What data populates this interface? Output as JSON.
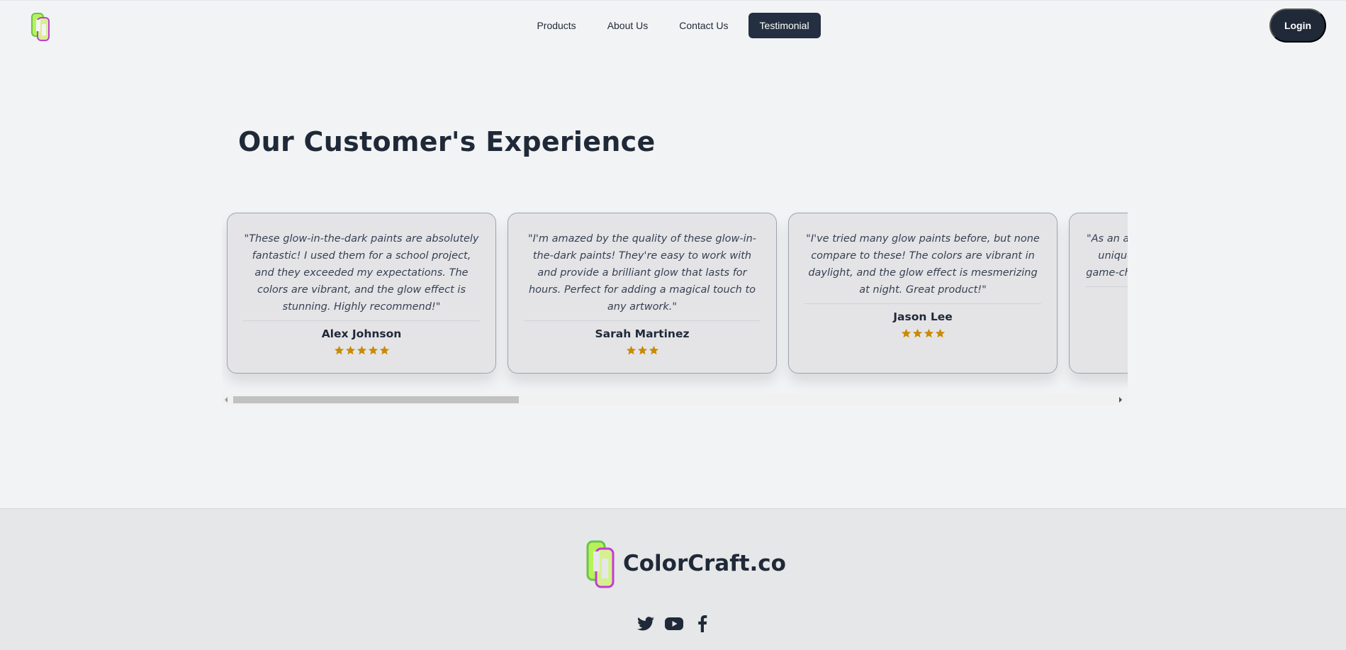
{
  "nav": {
    "items": [
      {
        "label": "Products"
      },
      {
        "label": "About Us"
      },
      {
        "label": "Contact Us"
      },
      {
        "label": "Testimonial"
      }
    ],
    "login_label": "Login"
  },
  "testimonials": {
    "title": "Our Customer's Experience",
    "cards": [
      {
        "quote": "\"These glow-in-the-dark paints are absolutely fantastic! I used them for a school project, and they exceeded my expectations. The colors are vibrant, and the glow effect is stunning. Highly recommend!\"",
        "author": "Alex Johnson",
        "rating": 5
      },
      {
        "quote": "\"I'm amazed by the quality of these glow-in-the-dark paints! They're easy to work with and provide a brilliant glow that lasts for hours. Perfect for adding a magical touch to any artwork.\"",
        "author": "Sarah Martinez",
        "rating": 3
      },
      {
        "quote": "\"I've tried many glow paints before, but none compare to these! The colors are vibrant in daylight, and the glow effect is mesmerizing at night. Great product!\"",
        "author": "Jason Lee",
        "rating": 4
      },
      {
        "quote": "\"As an artist, I love how these paints open up unique possibilities. They've been a total game-changer for my murals, and the glow is",
        "author": "",
        "rating": 0
      }
    ]
  },
  "footer": {
    "brand": "ColorCraft.co",
    "socials": [
      "twitter-icon",
      "youtube-icon",
      "facebook-icon"
    ]
  },
  "colors": {
    "dark": "#1f2937",
    "star": "#ca8a04",
    "card_bg": "#e4e4e7"
  }
}
